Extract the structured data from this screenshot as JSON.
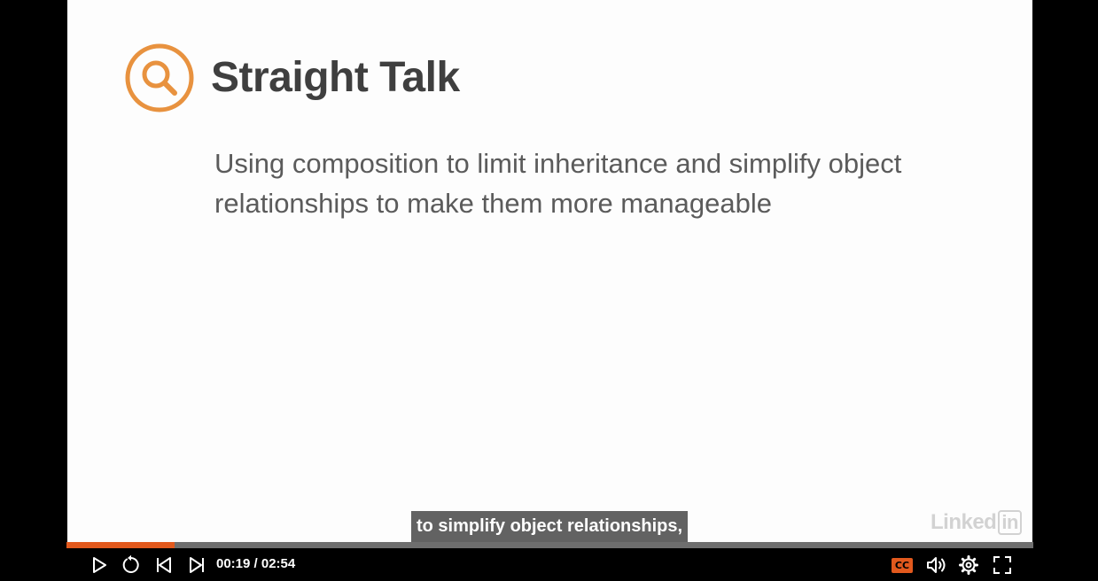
{
  "slide": {
    "title": "Straight Talk",
    "subtitle": "Using composition to limit inheritance and simplify object relationships to make them more manageable",
    "logo_icon": "magnifier-icon",
    "accent_color": "#e8923f"
  },
  "watermark": {
    "brand_prefix": "Linked",
    "brand_suffix": "in"
  },
  "caption": {
    "text": "to simplify object relationships,"
  },
  "progress": {
    "fraction": 0.112,
    "fill_color": "#e2591d"
  },
  "controls": {
    "time_display": "00:19 / 02:54",
    "cc_label": "CC",
    "icons": [
      "play-icon",
      "replay-icon",
      "previous-icon",
      "next-icon",
      "closed-captions-icon",
      "volume-icon",
      "settings-icon",
      "fullscreen-icon"
    ]
  }
}
